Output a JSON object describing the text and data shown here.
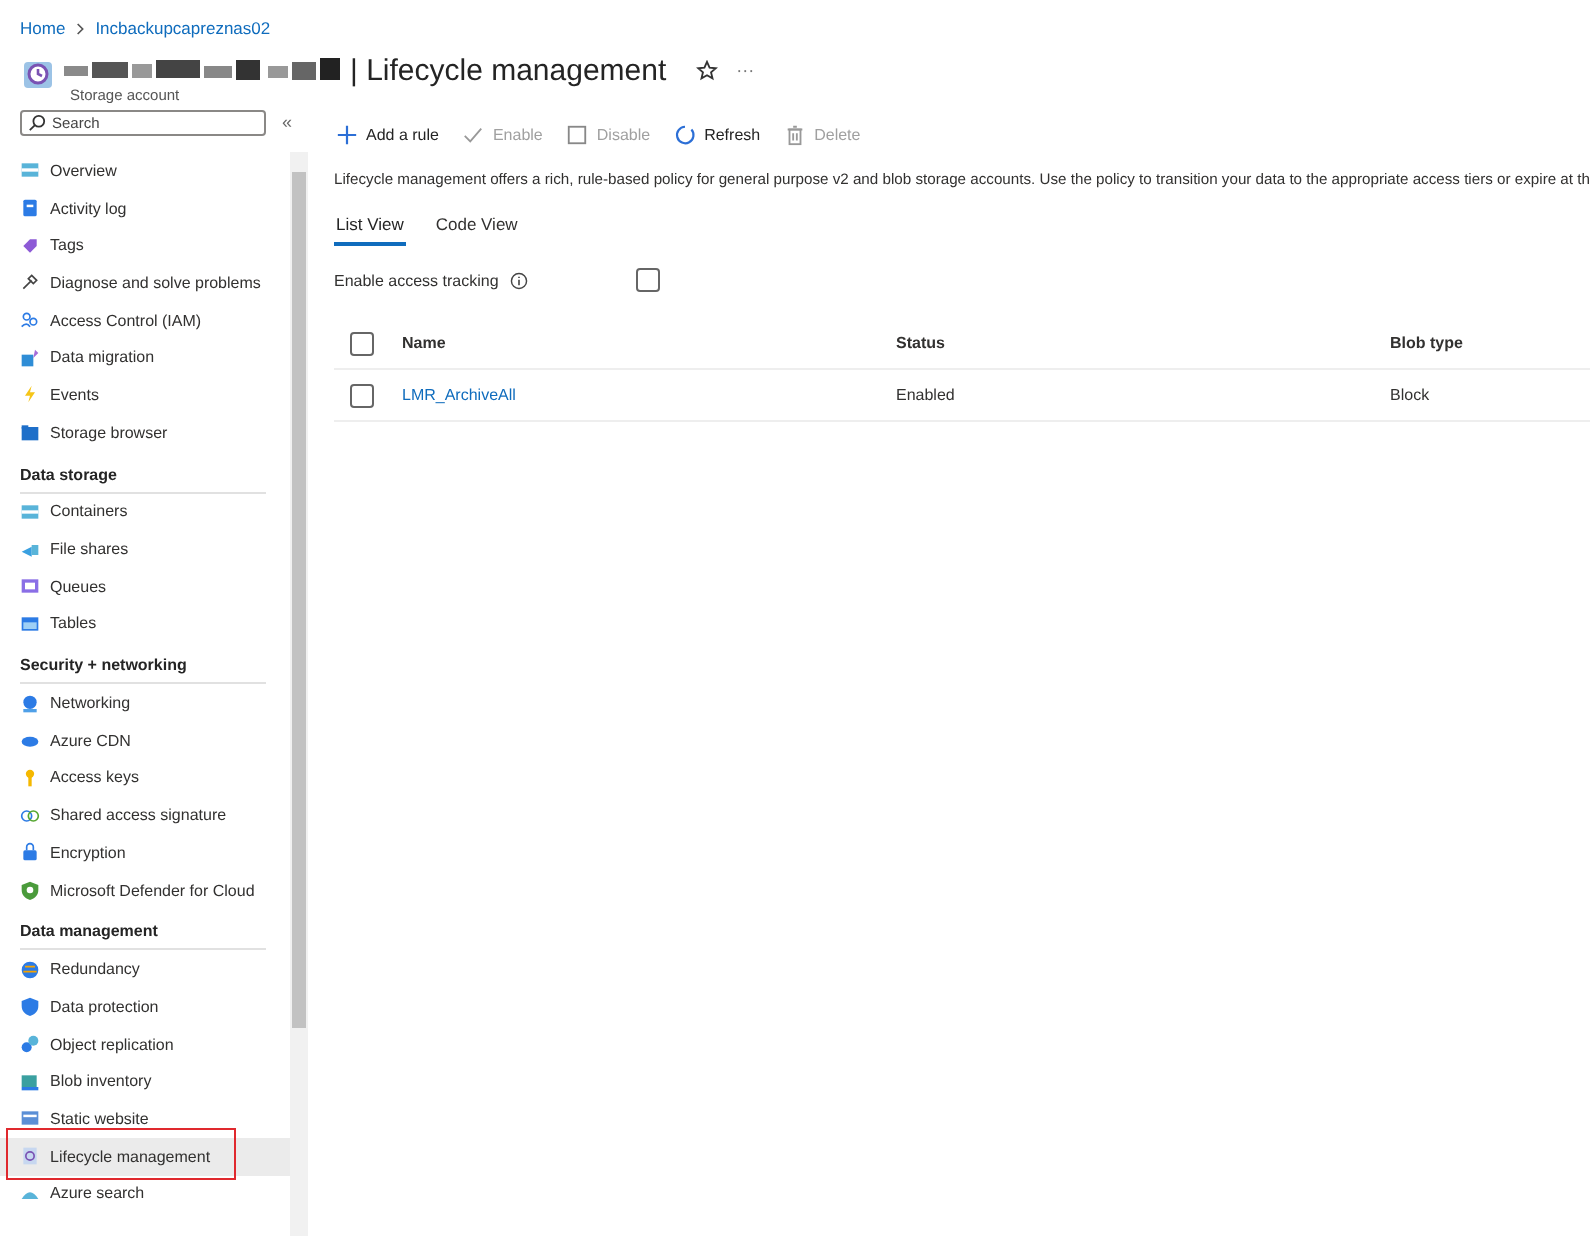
{
  "breadcrumb": [
    "Home",
    "Incbackupcapreznas02"
  ],
  "header": {
    "title": "| Lifecycle management",
    "subtitle": "Storage account",
    "more": "···"
  },
  "sidebar": {
    "search": {
      "placeholder": "Search"
    },
    "collapse": "«",
    "sections": [
      {
        "items": [
          {
            "label": "Overview",
            "selected": false
          },
          {
            "label": "Activity log",
            "selected": false
          },
          {
            "label": "Tags",
            "selected": false
          },
          {
            "label": "Diagnose and solve problems",
            "selected": false
          },
          {
            "label": "Access Control (IAM)",
            "selected": false
          },
          {
            "label": "Data migration",
            "selected": false
          },
          {
            "label": "Events",
            "selected": false
          },
          {
            "label": "Storage browser",
            "selected": false
          }
        ]
      },
      {
        "heading": "Data storage",
        "items": [
          {
            "label": "Containers",
            "selected": false
          },
          {
            "label": "File shares",
            "selected": false
          },
          {
            "label": "Queues",
            "selected": false
          },
          {
            "label": "Tables",
            "selected": false
          }
        ]
      },
      {
        "heading": "Security + networking",
        "items": [
          {
            "label": "Networking",
            "selected": false
          },
          {
            "label": "Azure CDN",
            "selected": false
          },
          {
            "label": "Access keys",
            "selected": false
          },
          {
            "label": "Shared access signature",
            "selected": false
          },
          {
            "label": "Encryption",
            "selected": false
          },
          {
            "label": "Microsoft Defender for Cloud",
            "selected": false
          }
        ]
      },
      {
        "heading": "Data management",
        "items": [
          {
            "label": "Redundancy",
            "selected": false
          },
          {
            "label": "Data protection",
            "selected": false
          },
          {
            "label": "Object replication",
            "selected": false
          },
          {
            "label": "Blob inventory",
            "selected": false
          },
          {
            "label": "Static website",
            "selected": false
          },
          {
            "label": "Lifecycle management",
            "selected": true
          },
          {
            "label": "Azure search",
            "selected": false
          }
        ]
      }
    ]
  },
  "toolbar": [
    {
      "label": "Add a rule",
      "disabled": false
    },
    {
      "label": "Enable",
      "disabled": true
    },
    {
      "label": "Disable",
      "disabled": true
    },
    {
      "label": "Refresh",
      "disabled": false
    },
    {
      "label": "Delete",
      "disabled": true
    }
  ],
  "description": "Lifecycle management offers a rich, rule-based policy for general purpose v2 and blob storage accounts. Use the policy to transition your data to the appropriate access tiers or expire at th",
  "tabs": [
    {
      "label": "List View",
      "selected": true
    },
    {
      "label": "Code View",
      "selected": false
    }
  ],
  "access_tracking": {
    "label": "Enable access tracking",
    "checked": false
  },
  "table": {
    "columns": [
      "Name",
      "Status",
      "Blob type"
    ],
    "all_selected": false,
    "rows": [
      {
        "name": "LMR_ArchiveAll",
        "status": "Enabled",
        "blob_type": "Block",
        "selected": false
      }
    ]
  }
}
